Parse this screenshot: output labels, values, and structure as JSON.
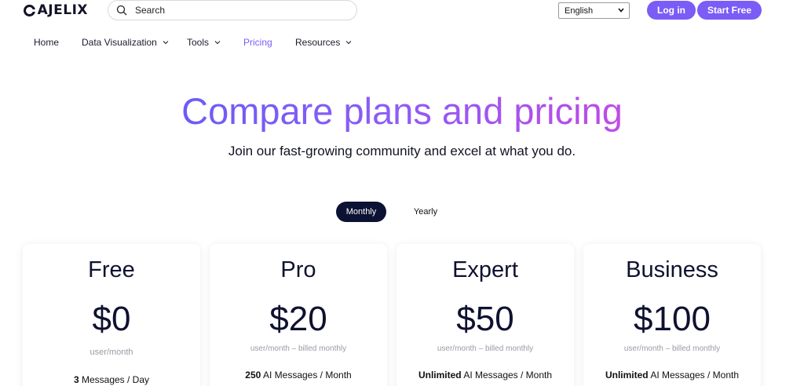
{
  "header": {
    "logo_text": "AJELIX",
    "search_placeholder": "Search",
    "language": "English",
    "login_label": "Log in",
    "start_label": "Start Free"
  },
  "nav": {
    "items": [
      {
        "label": "Home",
        "has_dropdown": false,
        "active": false
      },
      {
        "label": "Data Visualization",
        "has_dropdown": true,
        "active": false
      },
      {
        "label": "Tools",
        "has_dropdown": true,
        "active": false
      },
      {
        "label": "Pricing",
        "has_dropdown": false,
        "active": true
      },
      {
        "label": "Resources",
        "has_dropdown": true,
        "active": false
      }
    ]
  },
  "hero": {
    "title": "Compare plans and pricing",
    "subtitle": "Join our fast-growing community and excel at what you do."
  },
  "billing_toggle": {
    "monthly_label": "Monthly",
    "yearly_label": "Yearly",
    "selected": "Monthly"
  },
  "plans": [
    {
      "name": "Free",
      "price": "$0",
      "period": "user/month",
      "feature_strong": "3",
      "feature_rest": " Messages / Day"
    },
    {
      "name": "Pro",
      "price": "$20",
      "period": "user/month – billed monthly",
      "feature_strong": "250",
      "feature_rest": " AI Messages / Month"
    },
    {
      "name": "Expert",
      "price": "$50",
      "period": "user/month – billed monthly",
      "feature_strong": "Unlimited",
      "feature_rest": " AI Messages / Month"
    },
    {
      "name": "Business",
      "price": "$100",
      "period": "user/month – billed monthly",
      "feature_strong": "Unlimited",
      "feature_rest": " AI Messages / Month"
    }
  ],
  "colors": {
    "accent": "#7b5cf6",
    "toggle_active": "#0c1233",
    "text_dark": "#0f1130",
    "muted": "#9a9aa6"
  }
}
